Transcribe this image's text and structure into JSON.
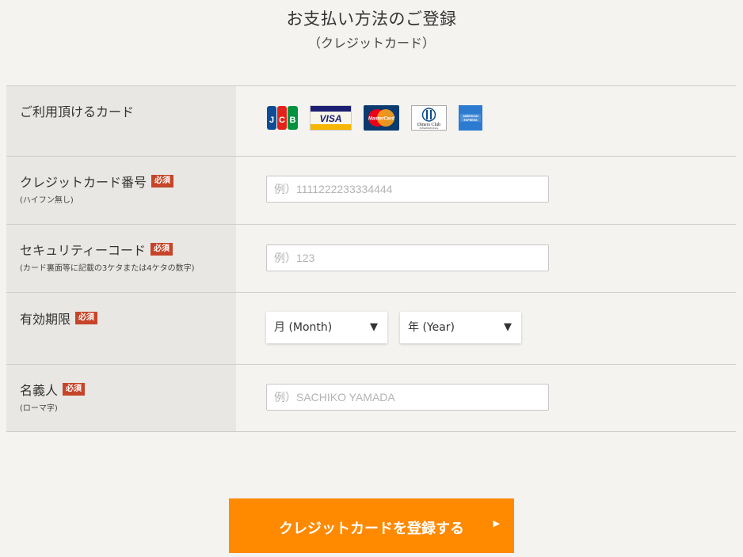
{
  "header": {
    "title": "お支払い方法のご登録",
    "subtitle": "（クレジットカード）"
  },
  "form": {
    "required_badge": "必須",
    "cards_row": {
      "label": "ご利用頂けるカード",
      "logos": [
        {
          "name": "jcb-logo",
          "text": "JCB"
        },
        {
          "name": "visa-logo",
          "text": "VISA"
        },
        {
          "name": "mastercard-logo",
          "text": "MasterCard"
        },
        {
          "name": "diners-club-logo",
          "text": "Diners Club"
        },
        {
          "name": "amex-logo",
          "text": "AMERICAN EXPRESS"
        }
      ]
    },
    "card_number": {
      "label": "クレジットカード番号",
      "sublabel": "(ハイフン無し)",
      "placeholder": "例）1111222233334444",
      "value": ""
    },
    "security_code": {
      "label": "セキュリティーコード",
      "sublabel": "(カード裏面等に記載の3ケタまたは4ケタの数字)",
      "placeholder": "例）123",
      "value": ""
    },
    "expiry": {
      "label": "有効期限",
      "month_selected": "月 (Month)",
      "year_selected": "年 (Year)"
    },
    "holder_name": {
      "label": "名義人",
      "sublabel": "(ローマ字)",
      "placeholder": "例）SACHIKO YAMADA",
      "value": ""
    }
  },
  "submit": {
    "label": "クレジットカードを登録する",
    "arrow": "▶"
  },
  "colors": {
    "background": "#f4f3f0",
    "label_background": "#e8e7e3",
    "required_badge": "#c6452a",
    "submit_button": "#ff8a00"
  }
}
